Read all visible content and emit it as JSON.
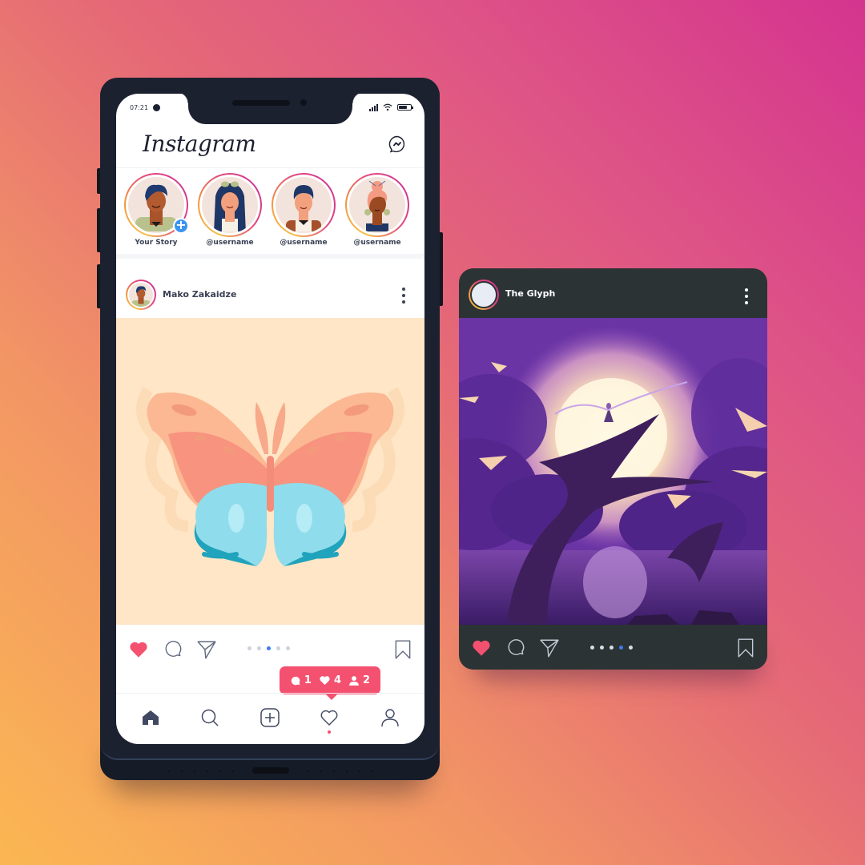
{
  "phone": {
    "status_bar": {
      "time": "07:21",
      "left_icon": "messenger-icon",
      "right_icons": [
        "signal-icon",
        "wifi-icon",
        "battery-icon"
      ]
    },
    "header": {
      "app_title": "Instagram",
      "right_icon": "messenger-icon"
    },
    "stories": [
      {
        "label": "Your Story",
        "has_add_badge": true,
        "add_symbol": "+"
      },
      {
        "label": "@username"
      },
      {
        "label": "@username"
      },
      {
        "label": "@username"
      }
    ],
    "post": {
      "author": "Mako Zakaidze",
      "image_subject": "butterfly illustration",
      "actions": [
        "heart-icon",
        "comment-icon",
        "share-icon",
        "bookmark-icon"
      ],
      "liked": true,
      "carousel": {
        "count": 5,
        "active_index": 2
      }
    },
    "notification": {
      "comments": "1",
      "likes": "4",
      "followers": "2"
    },
    "bottom_nav": [
      "home-icon",
      "search-icon",
      "add-post-icon",
      "activity-heart-icon",
      "profile-icon"
    ]
  },
  "card": {
    "author": "The Glyph",
    "image_subject": "purple fantasy landscape with glowing moon",
    "actions": [
      "heart-icon",
      "comment-icon",
      "share-icon",
      "bookmark-icon"
    ],
    "liked": true,
    "carousel": {
      "count": 5,
      "active_index": 3
    }
  },
  "colors": {
    "accent_like": "#f45170",
    "active_dot": "#3f7bf0",
    "phone_frame": "#1c2130",
    "card_bg": "#2c3334",
    "post_image_bg": "#fee6c6"
  }
}
